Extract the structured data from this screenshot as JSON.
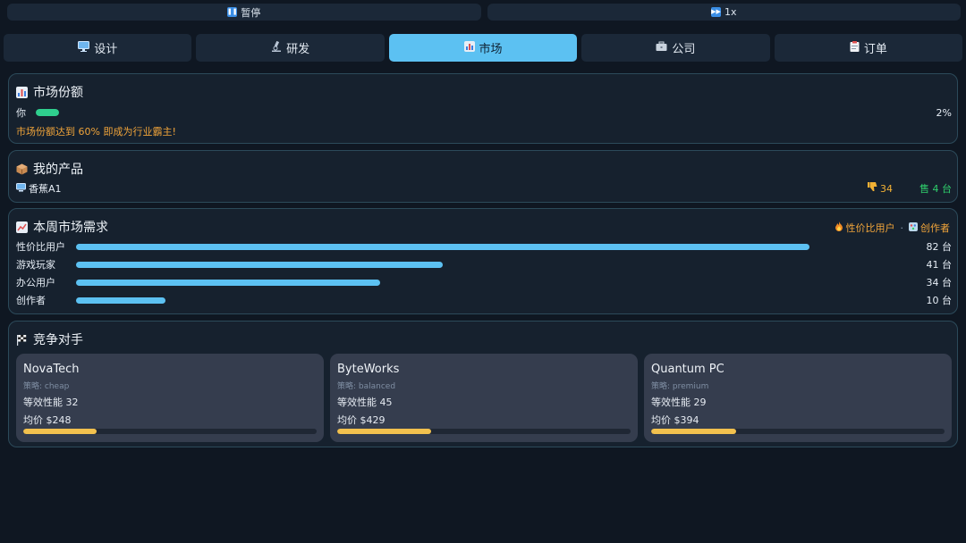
{
  "topbar": {
    "pause_label": "暂停",
    "speed_label": "1x"
  },
  "tabs": [
    {
      "label": "设计",
      "icon": "monitor-icon"
    },
    {
      "label": "研发",
      "icon": "microscope-icon"
    },
    {
      "label": "市场",
      "icon": "chart-icon",
      "active": true
    },
    {
      "label": "公司",
      "icon": "briefcase-icon"
    },
    {
      "label": "订单",
      "icon": "clipboard-icon"
    }
  ],
  "market_share": {
    "title": "市场份额",
    "player_label": "你",
    "player_pct_text": "2%",
    "player_pct": 2,
    "tip": "市场份额达到 60% 即成为行业霸主!"
  },
  "products": {
    "title": "我的产品",
    "items": [
      {
        "name": "香蕉A1",
        "dislikes": "34",
        "sold": "售 4 台"
      }
    ]
  },
  "demand": {
    "title": "本周市场需求",
    "legend_hot": "性价比用户",
    "legend_second": "创作者",
    "legend_sep": "·",
    "max": 92,
    "rows": [
      {
        "label": "性价比用户",
        "value": 82,
        "value_text": "82 台"
      },
      {
        "label": "游戏玩家",
        "value": 41,
        "value_text": "41 台"
      },
      {
        "label": "办公用户",
        "value": 34,
        "value_text": "34 台"
      },
      {
        "label": "创作者",
        "value": 10,
        "value_text": "10 台"
      }
    ]
  },
  "competitors": {
    "title": "竞争对手",
    "cards": [
      {
        "name": "NovaTech",
        "strategy": "策略: cheap",
        "perf": "等效性能 32",
        "price": "均价 $248",
        "share": 0.25
      },
      {
        "name": "ByteWorks",
        "strategy": "策略: balanced",
        "perf": "等效性能 45",
        "price": "均价 $429",
        "share": 0.32
      },
      {
        "name": "Quantum PC",
        "strategy": "策略: premium",
        "perf": "等效性能 29",
        "price": "均价 $394",
        "share": 0.29
      }
    ]
  },
  "colors": {
    "accent": "#5cc1f2",
    "share_fill": "#2fcf8e",
    "warning": "#f0a43a",
    "sold": "#2fcf6c",
    "competitor_bar": "#f2c14e"
  }
}
